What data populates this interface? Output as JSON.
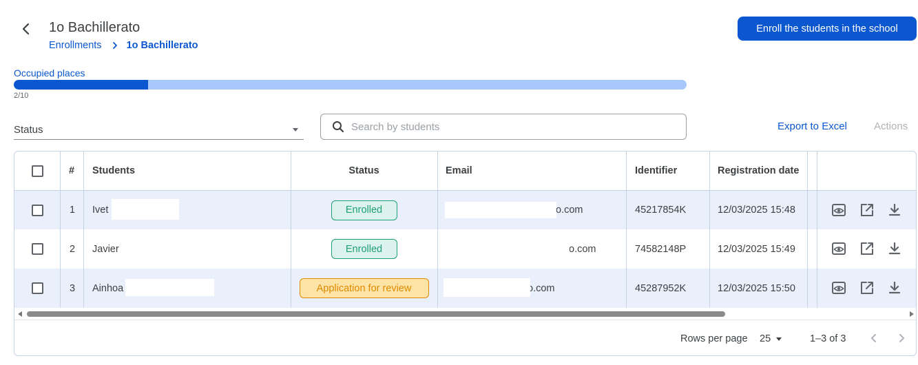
{
  "header": {
    "title": "1o Bachillerato",
    "breadcrumb": {
      "parent": "Enrollments",
      "current": "1o Bachillerato"
    },
    "enroll_button": "Enroll the students in the school"
  },
  "occupancy": {
    "label": "Occupied places",
    "count_text": "2/10",
    "occupied": 2,
    "total": 10
  },
  "filters": {
    "status_label": "Status",
    "search_placeholder": "Search by students",
    "export_label": "Export to Excel",
    "actions_label": "Actions"
  },
  "table": {
    "columns": {
      "number": "#",
      "students": "Students",
      "status": "Status",
      "email": "Email",
      "identifier": "Identifier",
      "registration_date": "Registration date"
    },
    "rows": [
      {
        "number": "1",
        "student": "Ivet",
        "status": "Enrolled",
        "status_type": "enrolled",
        "email": "o.com",
        "identifier": "45217854K",
        "registration_date": "12/03/2025 15:48"
      },
      {
        "number": "2",
        "student": "Javier",
        "status": "Enrolled",
        "status_type": "enrolled",
        "email": "o.com",
        "identifier": "74582148P",
        "registration_date": "12/03/2025 15:49"
      },
      {
        "number": "3",
        "student": "Ainhoa",
        "status": "Application for review",
        "status_type": "review",
        "email": "o.com",
        "identifier": "45287952K",
        "registration_date": "12/03/2025 15:50"
      }
    ]
  },
  "pagination": {
    "rows_per_page_label": "Rows per page",
    "rows_per_page": "25",
    "range": "1–3 of 3"
  },
  "colors": {
    "primary": "#0b57d0",
    "enrolled": "#1e9f75",
    "review": "#e08a00",
    "row_highlight": "#eaf0fb"
  }
}
